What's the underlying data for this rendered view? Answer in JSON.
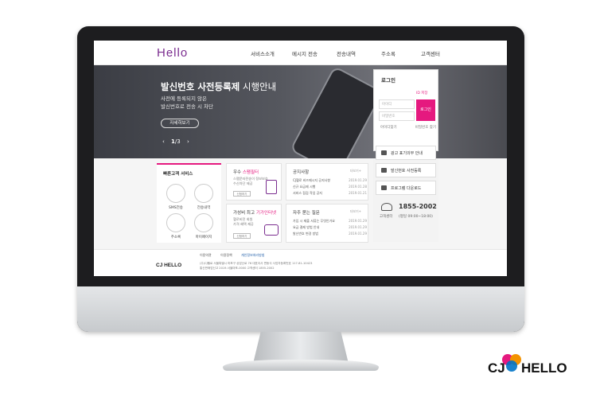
{
  "site": {
    "logo": "Hello",
    "nav": [
      "서비스소개",
      "메시지 전송",
      "전송내역",
      "주소록",
      "고객센터"
    ]
  },
  "hero": {
    "title_bold": "발신번호 사전등록제",
    "title_light": " 시행안내",
    "sub_line1": "사전에 등록되지 않은",
    "sub_line2": "발신번호로 전송 시 차단",
    "button": "자세히보기",
    "pager_prev": "‹",
    "pager_current": "1",
    "pager_total": "/3",
    "pager_next": "›"
  },
  "login": {
    "title": "로그인",
    "save_label": "ID 저장",
    "id_placeholder": "아이디",
    "pw_placeholder": "비밀번호",
    "button": "로그인",
    "find_label": "아이디찾기",
    "pw_find_label": "비밀번호 찾기"
  },
  "side": {
    "items": [
      "광고 표기의무 안내",
      "발신번호 사전등록",
      "프로그램 다운로드"
    ],
    "tel_label": "고객센터",
    "tel": "1855-2002",
    "hours": "(평일 09:00~18:00)"
  },
  "quick": {
    "title": "빠른고객 서비스",
    "items": [
      "SMS전송",
      "전송내역",
      "주소록",
      "마이페이지"
    ]
  },
  "cards": {
    "sms_title_prefix": "우수 ",
    "sms_title_hl": "스팸필터",
    "sms_text": [
      "스팸문자전송이 정보보호",
      "수신차단 제공"
    ],
    "sms_more": "신청하기",
    "price_title_prefix": "가성비 최고 ",
    "price_title_hl": "기가인터넷",
    "price_text": [
      "헬로비전 회원",
      "가격 혜택 제공"
    ],
    "price_more": "신청하기"
  },
  "notice": {
    "title": "공지사항",
    "more": "더보기+",
    "rows": [
      {
        "text": "CJ헬로 비즈메시지 공지사항",
        "date": "2019.01.29"
      },
      {
        "text": "신규 요금제 시행",
        "date": "2019.01.28"
      },
      {
        "text": "서비스 점검 작업 공지",
        "date": "2019.01.21"
      }
    ]
  },
  "faq": {
    "title": "자주 묻는 질문",
    "more": "더보기+",
    "rows": [
      {
        "text": "가입 시 제출 서류는 무엇인가요",
        "date": "2019.01.29"
      },
      {
        "text": "요금 결제 방법 안내",
        "date": "2019.01.29"
      },
      {
        "text": "발신번호 변경 방법",
        "date": "2019.01.29"
      }
    ]
  },
  "footer": {
    "links": [
      "이용약관",
      "이용정책",
      "개인정보처리방침"
    ],
    "addr1": "(주)CJ헬로 서울특별시 마포구 상암산로 76 대표이사 변동식 사업자등록번호 117-81-10423",
    "addr2": "통신판매업신고 2019-서울마포-0000 고객센터 1855-2002",
    "cj": "CJ HELLO"
  },
  "brand": {
    "cj": "CJ",
    "hello": "HELLO"
  },
  "colors": {
    "accent": "#e5197f",
    "brand_purple": "#7a2c8f"
  }
}
